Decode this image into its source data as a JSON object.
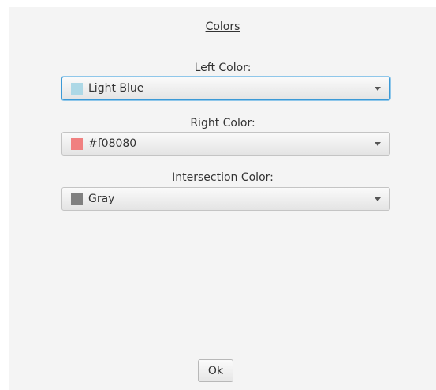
{
  "dialog": {
    "title": "Colors",
    "fields": [
      {
        "label": "Left Color:",
        "value": "Light Blue",
        "swatch": "#add8e6"
      },
      {
        "label": "Right Color:",
        "value": "#f08080",
        "swatch": "#f08080"
      },
      {
        "label": "Intersection Color:",
        "value": "Gray",
        "swatch": "#808080"
      }
    ],
    "ok_label": "Ok"
  },
  "colors": {
    "panel_background": "#f4f4f4",
    "focus_border": "#3b99d6"
  }
}
